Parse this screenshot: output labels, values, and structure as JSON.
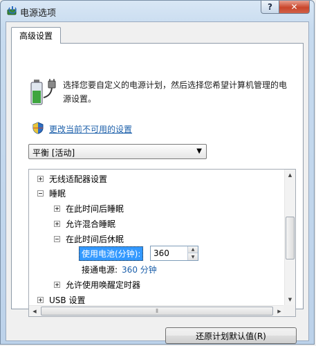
{
  "window": {
    "title": "电源选项",
    "help_label": "?",
    "close_label": "✕"
  },
  "tab": {
    "label": "高级设置"
  },
  "description": "选择您要自定义的电源计划，然后选择您希望计算机管理的电源设置。",
  "change_link": "更改当前不可用的设置",
  "plan_select": {
    "value": "平衡 [活动]"
  },
  "tree": {
    "items": [
      {
        "label": "无线适配器设置",
        "state": "collapsed"
      },
      {
        "label": "睡眠",
        "state": "expanded"
      },
      {
        "label": "在此时间后睡眠",
        "state": "collapsed"
      },
      {
        "label": "允许混合睡眠",
        "state": "collapsed"
      },
      {
        "label": "在此时间后休眠",
        "state": "expanded"
      },
      {
        "label": "允许使用唤醒定时器",
        "state": "collapsed"
      },
      {
        "label": "USB 设置",
        "state": "collapsed"
      }
    ],
    "battery_label": "使用电池(分钟):",
    "battery_value": "360",
    "ac_label": "接通电源:",
    "ac_value": "360 分钟"
  },
  "restore_button": "还原计划默认值(R)",
  "colors": {
    "link": "#1b5faa",
    "selection": "#3399ff",
    "close": "#c9452b"
  }
}
